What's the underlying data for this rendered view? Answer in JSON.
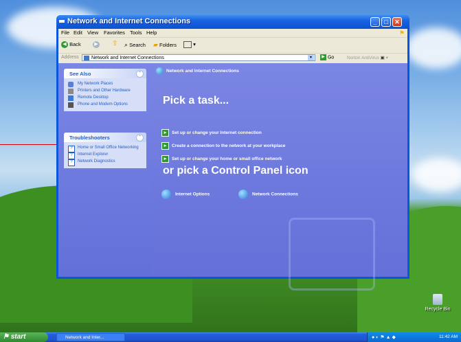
{
  "window": {
    "title": "Network and Internet Connections"
  },
  "menu": [
    "File",
    "Edit",
    "View",
    "Favorites",
    "Tools",
    "Help"
  ],
  "toolbar": {
    "back": "Back",
    "search": "Search",
    "folders": "Folders"
  },
  "address": {
    "label": "Address",
    "value": "Network and Internet Connections",
    "go": "Go",
    "norton": "Norton AntiVirus"
  },
  "see_also": {
    "title": "See Also",
    "items": [
      "My Network Places",
      "Printers and Other Hardware",
      "Remote Desktop",
      "Phone and Modem Options"
    ]
  },
  "troubleshooters": {
    "title": "Troubleshooters",
    "items": [
      "Home or Small Office Networking",
      "Internet Explorer",
      "Network Diagnostics"
    ]
  },
  "main": {
    "header": "Network and Internet Connections",
    "pick_task": "Pick a task...",
    "tasks": [
      "Set up or change your Internet connection",
      "Create a connection to the network at your workplace",
      "Set up or change your home or small office network"
    ],
    "or_pick": "or pick a Control Panel icon",
    "icons": [
      "Internet Options",
      "Network Connections"
    ]
  },
  "taskbar": {
    "start": "start",
    "button": "Network and Inter...",
    "clock": "11:42 AM"
  },
  "desktop": {
    "recycle_bin": "Recycle Bin"
  },
  "colors": {
    "accent": "#215dc6",
    "arrow": "#dd0000"
  }
}
